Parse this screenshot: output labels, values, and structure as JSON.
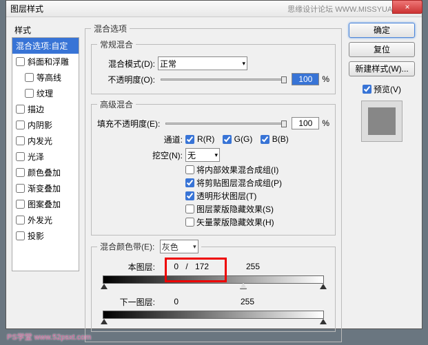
{
  "window": {
    "title": "图层样式",
    "brand": "思缘设计论坛 WWW.MISSYUAN.COM",
    "close": "×"
  },
  "left": {
    "header": "样式",
    "items": [
      {
        "label": "混合选项:自定",
        "selected": true,
        "noCheck": true
      },
      {
        "label": "斜面和浮雕"
      },
      {
        "label": "等高线",
        "sub": true
      },
      {
        "label": "纹理",
        "sub": true
      },
      {
        "label": "描边"
      },
      {
        "label": "内阴影"
      },
      {
        "label": "内发光"
      },
      {
        "label": "光泽"
      },
      {
        "label": "颜色叠加"
      },
      {
        "label": "渐变叠加"
      },
      {
        "label": "图案叠加"
      },
      {
        "label": "外发光"
      },
      {
        "label": "投影"
      }
    ]
  },
  "center": {
    "blendOptions": "混合选项",
    "general": {
      "legend": "常规混合",
      "blendMode": {
        "label": "混合模式(D):",
        "value": "正常"
      },
      "opacity": {
        "label": "不透明度(O):",
        "value": "100",
        "unit": "%"
      }
    },
    "advanced": {
      "legend": "高级混合",
      "fillOpacity": {
        "label": "填充不透明度(E):",
        "value": "100",
        "unit": "%"
      },
      "channels": {
        "label": "通道:",
        "r": "R(R)",
        "g": "G(G)",
        "b": "B(B)"
      },
      "knockout": {
        "label": "挖空(N):",
        "value": "无"
      },
      "checks": [
        "将内部效果混合成组(I)",
        "将剪贴图层混合成组(P)",
        "透明形状图层(T)",
        "图层蒙版隐藏效果(S)",
        "矢量蒙版隐藏效果(H)"
      ],
      "checksState": [
        false,
        true,
        true,
        false,
        false
      ]
    },
    "blendIf": {
      "legend": "混合颜色带(E):",
      "channel": "灰色",
      "thisLayer": {
        "label": "本图层:",
        "low": "0",
        "sep": "/",
        "high": "172",
        "max": "255"
      },
      "underlying": {
        "label": "下一图层:",
        "low": "0",
        "max": "255"
      }
    }
  },
  "right": {
    "ok": "确定",
    "reset": "复位",
    "newStyle": "新建样式(W)...",
    "preview": "预览(V)"
  },
  "watermark": "PS学堂   www.52psxt.com"
}
